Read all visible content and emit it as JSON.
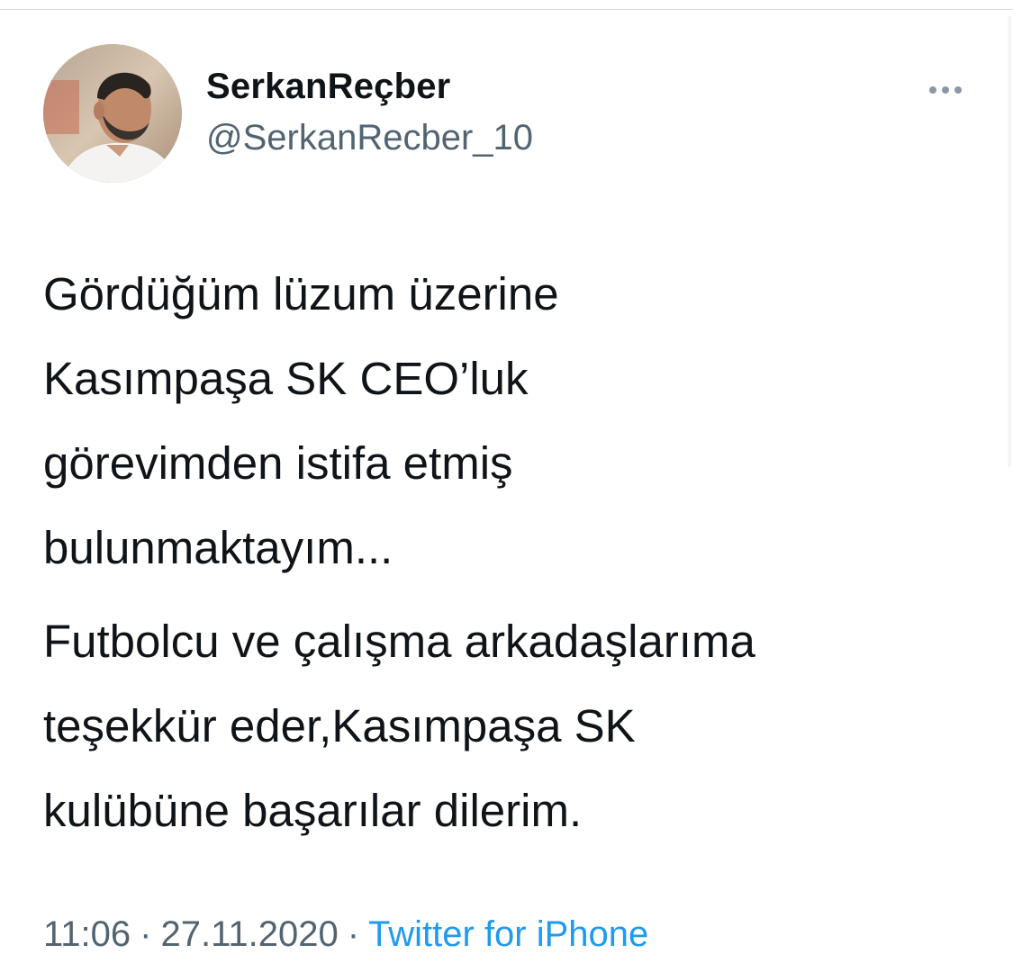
{
  "tweet": {
    "author": {
      "display_name": "SerkanReçber",
      "handle": "@SerkanRecber_10"
    },
    "more_icon": "more-horizontal-icon",
    "text_paragraphs": [
      {
        "lines": [
          "Gördüğüm lüzum üzerine",
          "Kasımpaşa SK CEO’luk",
          "görevimden istifa etmiş",
          "bulunmaktayım..."
        ]
      },
      {
        "lines": [
          "Futbolcu ve çalışma arkadaşlarıma",
          "teşekkür eder,Kasımpaşa SK",
          "kulübüne başarılar dilerim."
        ]
      }
    ],
    "time": "11:06",
    "separator": "·",
    "date": "27.11.2020",
    "source": "Twitter for iPhone"
  },
  "colors": {
    "text_primary": "#0f1419",
    "text_secondary": "#536471",
    "link": "#1d9bf0",
    "divider": "#d8dde1"
  }
}
